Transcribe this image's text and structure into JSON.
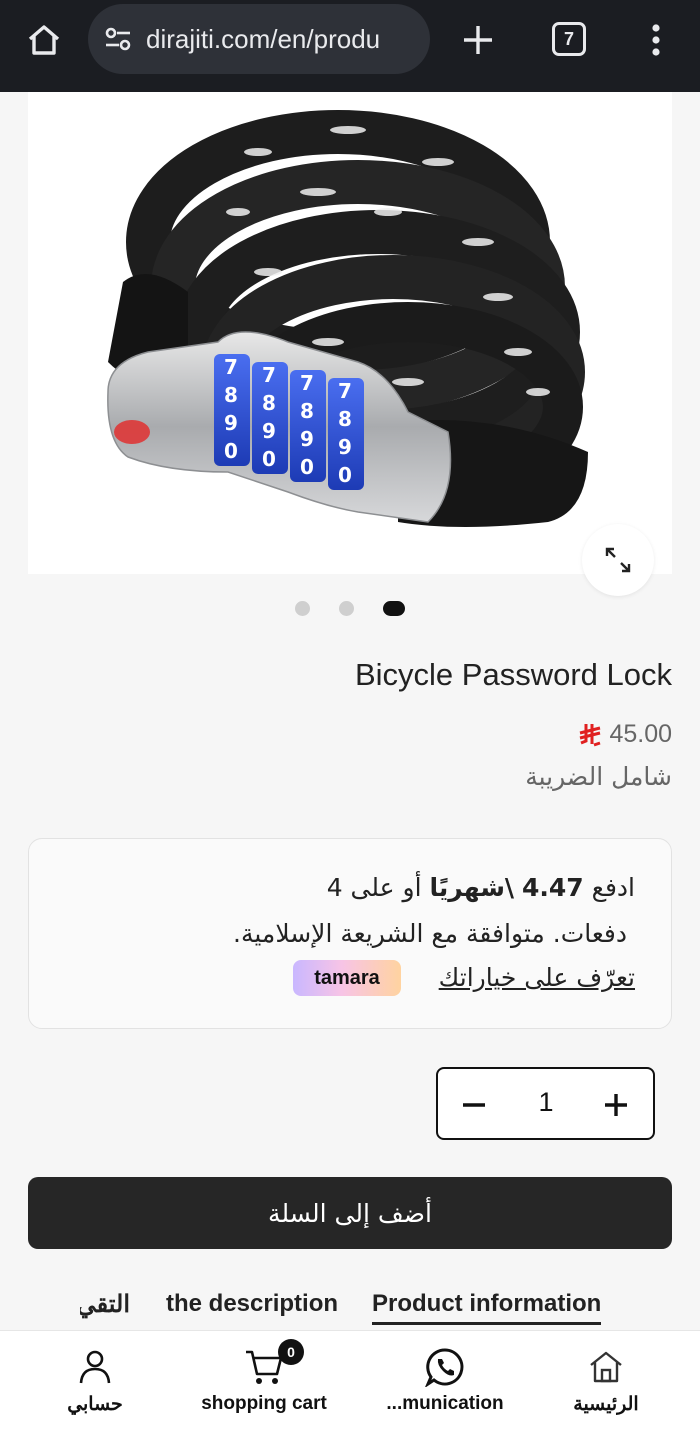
{
  "browser": {
    "url": "dirajiti.com/en/produ",
    "tab_count": "7"
  },
  "product": {
    "title": "Bicycle Password Lock",
    "price": "45.00",
    "tax_note": "شامل الضريبة",
    "image_carousel": {
      "total": 3,
      "active_index": 3
    }
  },
  "tamara": {
    "pay_prefix": "ادفع",
    "monthly_amount": "4.47",
    "monthly_suffix": "\\شهريًا",
    "installments": "أو على 4",
    "line2": "دفعات. متوافقة مع الشريعة الإسلامية.",
    "learn_more": "تعرّف على خياراتك",
    "brand": "tamara",
    "brand_colors": [
      "#c9b7ff",
      "#f7c4e6",
      "#ffd3a0"
    ]
  },
  "quantity": {
    "value": "1"
  },
  "add_to_cart_label": "أضف إلى السلة",
  "tabs": [
    {
      "label": "Product information",
      "active": true
    },
    {
      "label": "the description",
      "active": false
    },
    {
      "label": "التقي",
      "active": false
    }
  ],
  "bottom_nav": {
    "home": "الرئيسية",
    "communication": "...munication",
    "cart": "shopping cart",
    "cart_count": "0",
    "account": "حسابي"
  },
  "colors": {
    "accent": "#262626",
    "riyal_symbol": "#e02020",
    "lock_dial": "#2c4fd6"
  }
}
